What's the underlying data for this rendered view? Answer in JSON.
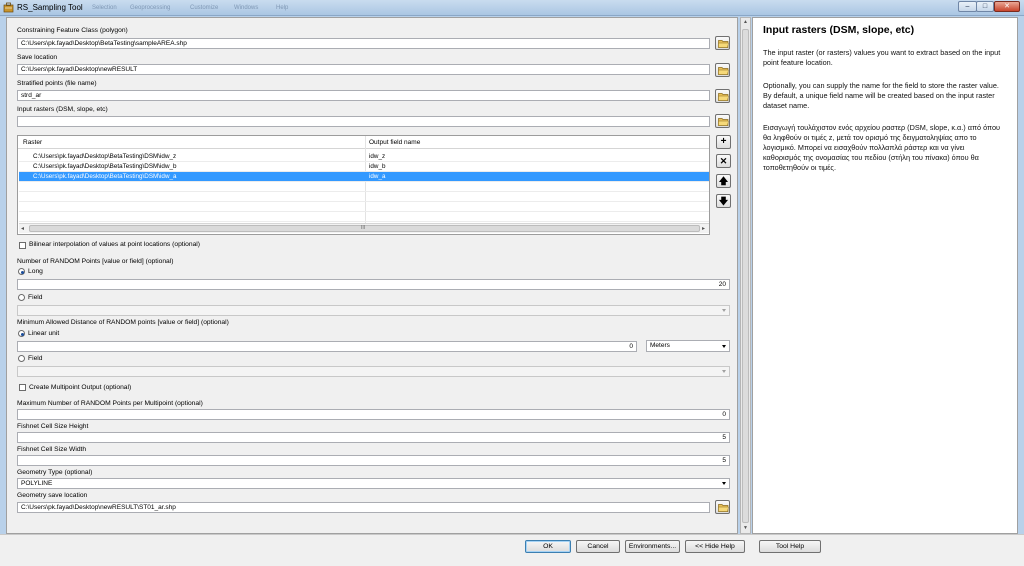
{
  "window": {
    "title": "RS_Sampling Tool",
    "ghost_menu": [
      "Selection",
      "Geoprocessing",
      "Customize",
      "Windows",
      "Help"
    ],
    "controls": {
      "minimize": "–",
      "maximize": "□",
      "close": "✕"
    }
  },
  "form": {
    "constraining": {
      "label": "Constraining Feature Class (polygon)",
      "value": "C:\\Users\\pk.fayad\\Desktop\\BetaTesting\\sampleAREA.shp"
    },
    "save_location": {
      "label": "Save location",
      "value": "C:\\Users\\pk.fayad\\Desktop\\newRESULT"
    },
    "stratified": {
      "label": "Stratified points (file name)",
      "value": "strd_ar"
    },
    "input_rasters": {
      "label": "Input rasters (DSM, slope, etc)",
      "value": "",
      "columns": [
        "Raster",
        "Output field name"
      ],
      "rows": [
        {
          "raster": "C:\\Users\\pk.fayad\\Desktop\\BetaTesting\\DSM\\idw_z",
          "field": "idw_z",
          "selected": false
        },
        {
          "raster": "C:\\Users\\pk.fayad\\Desktop\\BetaTesting\\DSM\\idw_b",
          "field": "idw_b",
          "selected": false
        },
        {
          "raster": "C:\\Users\\pk.fayad\\Desktop\\BetaTesting\\DSM\\idw_a",
          "field": "idw_a",
          "selected": true
        }
      ],
      "scroll_grip": "III"
    },
    "bilinear": {
      "label": "Bilinear interpolation of values at point locations (optional)",
      "checked": false
    },
    "random_points": {
      "label": "Number of RANDOM Points [value or field] (optional)",
      "option_long": "Long",
      "long_value": "20",
      "option_field": "Field",
      "field_value": ""
    },
    "min_distance": {
      "label": "Minimum Allowed Distance of RANDOM points [value or field] (optional)",
      "option_linear": "Linear unit",
      "linear_value": "0",
      "unit": "Meters",
      "option_field": "Field",
      "field_value": ""
    },
    "multipoint": {
      "label": "Create Multipoint Output (optional)",
      "checked": false
    },
    "max_per_multipoint": {
      "label": "Maximum Number of RANDOM Points per Multipoint (optional)",
      "value": "0"
    },
    "cell_height": {
      "label": "Fishnet Cell Size Height",
      "value": "5"
    },
    "cell_width": {
      "label": "Fishnet Cell Size Width",
      "value": "5"
    },
    "geometry_type": {
      "label": "Geometry Type (optional)",
      "value": "POLYLINE"
    },
    "geometry_save": {
      "label": "Geometry save location",
      "value": "C:\\Users\\pk.fayad\\Desktop\\newRESULT\\ST01_ar.shp"
    }
  },
  "help": {
    "title": "Input rasters (DSM, slope, etc)",
    "p1": "The input raster (or rasters) values you want to extract based on the input point feature location.",
    "p2": "Optionally, you can supply the name for the field to store the raster value. By default, a unique field name will be created based on the input raster dataset name.",
    "p3": "Εισαγωγή τουλάχιστον ενός αρχείου ραστερ (DSM, slope, κ.α.) από όπου θα ληφθούν οι τιμές z, μετά τον ορισμό της δειγματοληψίας απο το λογισμικό. Μπορεί να εισαχθούν πολλαπλά ράστερ και να γίνει καθορισμός της ονομασίας του πεδίου (στήλη του πίνακα) όπου θα τοποθετηθούν οι τιμές."
  },
  "buttons": {
    "ok": "OK",
    "cancel": "Cancel",
    "environments": "Environments...",
    "hide_help": "<< Hide Help",
    "tool_help": "Tool Help"
  },
  "colors": {
    "selection": "#3399ff",
    "title_bar": "#b9d1ea",
    "close": "#c8442c"
  }
}
